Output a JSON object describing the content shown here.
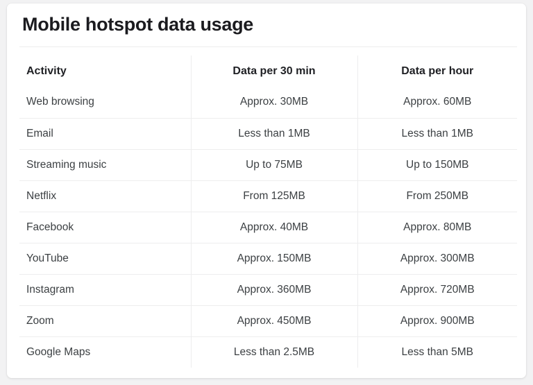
{
  "card": {
    "title": "Mobile hotspot data usage"
  },
  "table": {
    "columns": [
      {
        "label": "Activity",
        "align": "left"
      },
      {
        "label": "Data per 30 min",
        "align": "center"
      },
      {
        "label": "Data per hour",
        "align": "center"
      }
    ],
    "rows": [
      {
        "activity": "Web browsing",
        "per_30_min": "Approx. 30MB",
        "per_hour": "Approx. 60MB"
      },
      {
        "activity": "Email",
        "per_30_min": "Less than 1MB",
        "per_hour": "Less than 1MB"
      },
      {
        "activity": "Streaming music",
        "per_30_min": "Up to 75MB",
        "per_hour": "Up to 150MB"
      },
      {
        "activity": "Netflix",
        "per_30_min": "From 125MB",
        "per_hour": "From 250MB"
      },
      {
        "activity": "Facebook",
        "per_30_min": "Approx. 40MB",
        "per_hour": "Approx. 80MB"
      },
      {
        "activity": "YouTube",
        "per_30_min": "Approx. 150MB",
        "per_hour": "Approx. 300MB"
      },
      {
        "activity": "Instagram",
        "per_30_min": "Approx. 360MB",
        "per_hour": "Approx. 720MB"
      },
      {
        "activity": "Zoom",
        "per_30_min": "Approx. 450MB",
        "per_hour": "Approx. 900MB"
      },
      {
        "activity": "Google Maps",
        "per_30_min": "Less than 2.5MB",
        "per_hour": "Less than 5MB"
      }
    ]
  },
  "colors": {
    "page_background": "#f2f2f3",
    "card_background": "#ffffff",
    "title_text": "#1b1b1f",
    "header_text": "#1f2024",
    "body_text": "#3c4043",
    "rule": "#ededee"
  }
}
